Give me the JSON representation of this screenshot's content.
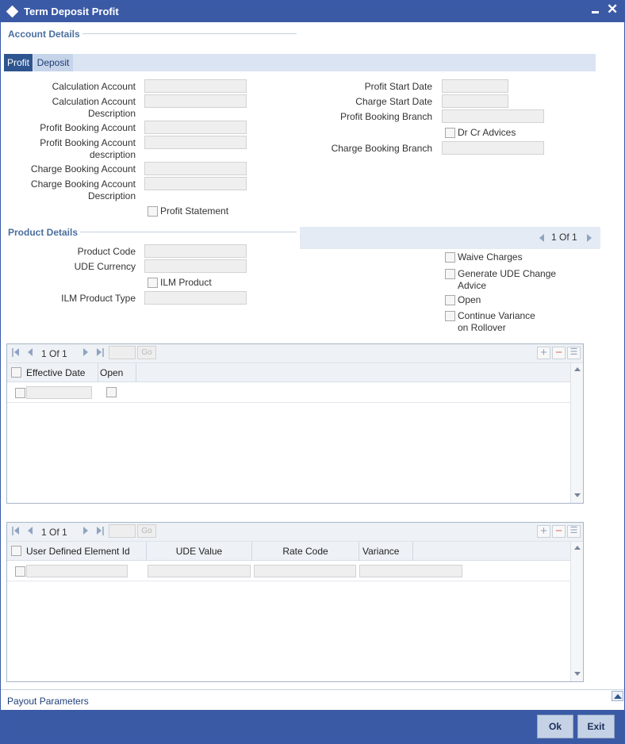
{
  "window": {
    "title": "Term Deposit Profit"
  },
  "account_details": {
    "heading": "Account Details",
    "tabs": [
      {
        "label": "Profit",
        "active": true
      },
      {
        "label": "Deposit",
        "active": false
      }
    ],
    "left_fields": [
      {
        "label": "Calculation Account",
        "value": ""
      },
      {
        "label": "Calculation Account Description",
        "value": ""
      },
      {
        "label": "Profit Booking Account",
        "value": ""
      },
      {
        "label": "Profit Booking Account description",
        "value": ""
      },
      {
        "label": "Charge Booking Account",
        "value": ""
      },
      {
        "label": "Charge Booking Account Description",
        "value": ""
      }
    ],
    "profit_statement": {
      "label": "Profit Statement",
      "checked": false
    },
    "right_fields": [
      {
        "label": "Profit Start Date",
        "value": ""
      },
      {
        "label": "Charge Start Date",
        "value": ""
      },
      {
        "label": "Profit Booking Branch",
        "value": ""
      },
      {
        "label": "Charge Booking Branch",
        "value": ""
      }
    ],
    "dr_cr_advices": {
      "label": "Dr Cr Advices",
      "checked": false
    }
  },
  "product_details": {
    "heading": "Product Details",
    "fields": [
      {
        "label": "Product Code",
        "value": ""
      },
      {
        "label": "UDE Currency",
        "value": ""
      },
      {
        "label": "ILM Product Type",
        "value": ""
      }
    ],
    "ilm_product": {
      "label": "ILM Product",
      "checked": false
    },
    "pager": {
      "text": "1 Of 1"
    },
    "options": [
      {
        "label_line1": "Waive Charges",
        "label_line2": "",
        "checked": false
      },
      {
        "label_line1": "Generate UDE Change",
        "label_line2": "Advice",
        "checked": false
      },
      {
        "label_line1": "Open",
        "label_line2": "",
        "checked": false
      },
      {
        "label_line1": "Continue Variance",
        "label_line2": "on Rollover",
        "checked": false
      }
    ]
  },
  "grid1": {
    "pager_text": "1 Of 1",
    "go_label": "Go",
    "columns": [
      "Effective Date",
      "Open"
    ],
    "rows": [
      {
        "effective_date": "",
        "open": false
      }
    ]
  },
  "grid2": {
    "pager_text": "1 Of 1",
    "go_label": "Go",
    "columns": [
      "User Defined Element Id",
      "UDE Value",
      "Rate Code",
      "Variance"
    ],
    "rows": [
      {
        "element_id": "",
        "ude_value": "",
        "rate_code": "",
        "variance": ""
      }
    ]
  },
  "payout": {
    "label": "Payout Parameters"
  },
  "footer": {
    "ok_label": "Ok",
    "exit_label": "Exit"
  },
  "colors": {
    "titlebar": "#3b5aa6",
    "active_tab": "#2e5590",
    "section_title": "#4a6f9e"
  },
  "icons": [
    "diamond-icon",
    "minimize-icon",
    "close-icon",
    "first-page-icon",
    "prev-page-icon",
    "next-page-icon",
    "last-page-icon",
    "add-row-icon",
    "delete-row-icon",
    "single-view-icon",
    "collapse-icon"
  ]
}
